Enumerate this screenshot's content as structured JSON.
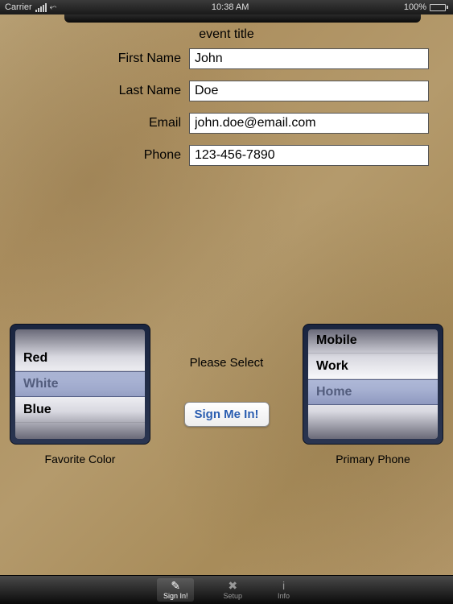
{
  "status": {
    "carrier": "Carrier",
    "time": "10:38 AM",
    "battery": "100%"
  },
  "header": {
    "event_title": "event title"
  },
  "form": {
    "first_name": {
      "label": "First Name",
      "value": "John"
    },
    "last_name": {
      "label": "Last Name",
      "value": "Doe"
    },
    "email": {
      "label": "Email",
      "value": "john.doe@email.com"
    },
    "phone": {
      "label": "Phone",
      "value": "123-456-7890"
    }
  },
  "pickers": {
    "left": {
      "caption": "Favorite Color",
      "options": [
        "Red",
        "White",
        "Blue"
      ],
      "selected_index": 1
    },
    "right": {
      "caption": "Primary Phone",
      "options": [
        "Mobile",
        "Work",
        "Home"
      ],
      "selected_index": 2
    },
    "center_label": "Please Select"
  },
  "buttons": {
    "signin": "Sign Me In!"
  },
  "tabbar": {
    "items": [
      {
        "label": "Sign In!",
        "icon": "✎",
        "active": true
      },
      {
        "label": "Setup",
        "icon": "✖",
        "active": false
      },
      {
        "label": "Info",
        "icon": "i",
        "active": false
      }
    ]
  }
}
